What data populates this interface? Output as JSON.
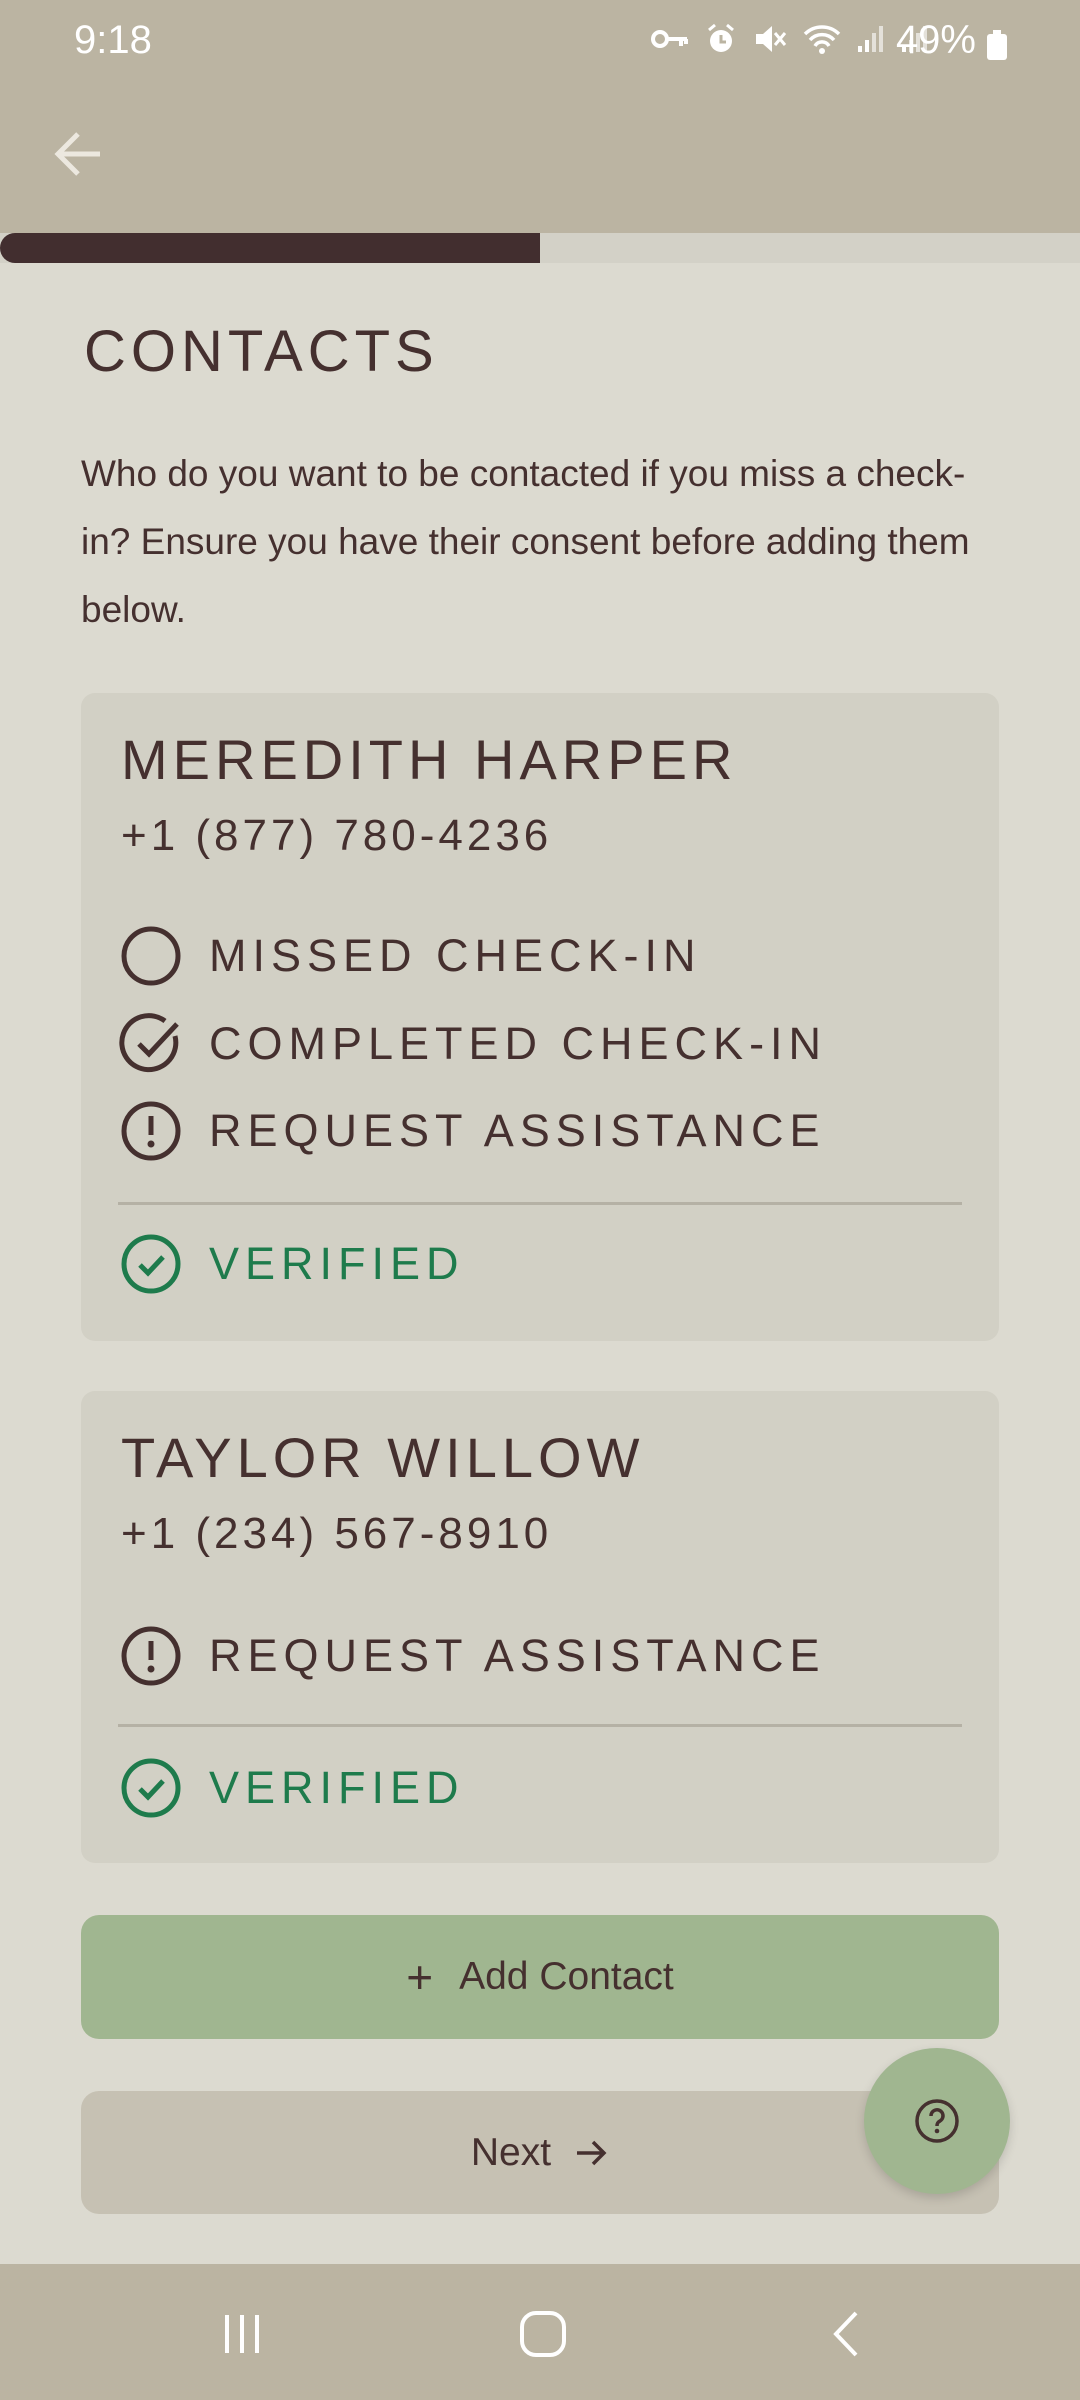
{
  "status_bar": {
    "time": "9:18",
    "battery": "49%",
    "icons": [
      "vpn-key-icon",
      "alarm-icon",
      "mute-icon",
      "wifi-icon",
      "signal-icon",
      "signal-icon",
      "battery-icon"
    ]
  },
  "header": {
    "back_icon": "arrow-left-icon"
  },
  "progress": {
    "value_percent": 50,
    "fill_color": "#422e2f"
  },
  "page": {
    "title": "CONTACTS",
    "intro": "Who do you want to be contacted if you miss a check-in? Ensure you have their consent before adding them below."
  },
  "contacts": [
    {
      "name": "MEREDITH HARPER",
      "phone": "+1 (877) 780-4236",
      "options": [
        {
          "label": "MISSED CHECK-IN",
          "icon": "circle-empty-icon",
          "checked": false
        },
        {
          "label": "COMPLETED CHECK-IN",
          "icon": "circle-check-icon",
          "checked": true
        },
        {
          "label": "REQUEST ASSISTANCE",
          "icon": "alert-circle-icon",
          "checked": true
        }
      ],
      "status": "VERIFIED"
    },
    {
      "name": "TAYLOR WILLOW",
      "phone": "+1 (234) 567-8910",
      "options": [
        {
          "label": "REQUEST ASSISTANCE",
          "icon": "alert-circle-icon",
          "checked": true
        }
      ],
      "status": "VERIFIED"
    }
  ],
  "actions": {
    "add_contact": "Add Contact",
    "next": "Next"
  },
  "help": {
    "icon": "help-circle-icon"
  },
  "colors": {
    "accent_green": "#a0b690",
    "verified_green": "#1e7b4c",
    "text_brown": "#45302f",
    "bar_beige": "#bbb4a2"
  }
}
